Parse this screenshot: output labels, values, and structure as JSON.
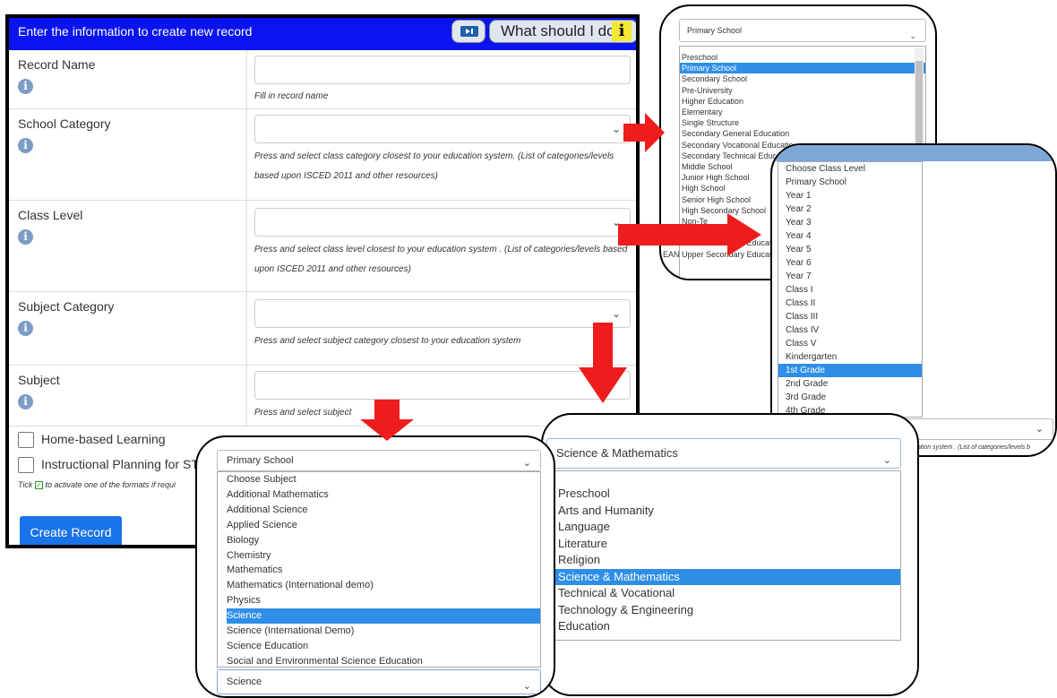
{
  "form": {
    "header": "Enter the information to create new record",
    "help_label": "What should I do?",
    "help_icon": "i",
    "info_icon": "i",
    "fields": [
      {
        "label": "Record Name",
        "hint": "Fill in record name",
        "type": "text"
      },
      {
        "label": "School Category",
        "hint": "Press and select class category closest to your education system. (List of categories/levels based upon ISCED 2011 and other resources)",
        "type": "select"
      },
      {
        "label": "Class Level",
        "hint": "Press and select class level closest to your education system . (List of categories/levels based upon ISCED 2011 and other resources)",
        "type": "select"
      },
      {
        "label": "Subject Category",
        "hint": "Press and select subject category closest to your education system",
        "type": "select"
      },
      {
        "label": "Subject",
        "hint": "Press and select subject",
        "type": "text"
      }
    ],
    "checkboxes": [
      "Home-based Learning",
      "Instructional Planning for STE"
    ],
    "checkbox_hint_prefix": "Tick",
    "checkbox_hint_suffix": "to activate one of the formats if requi",
    "create_button": "Create Record"
  },
  "school_panel": {
    "selected_value": "Primary School",
    "options": [
      "Preschool",
      "Primary School",
      "Secondary School",
      "Pre-University",
      "Higher Education",
      "Elementary",
      "Single Structure",
      "Secondary General Education",
      "Secondary Vocational Educatio",
      "Secondary Technical Educatio",
      "Middle School",
      "Junior High School",
      "High School",
      "Senior High School",
      "High Secondary School",
      "Non-Te",
      "Tertiary Education",
      "Lower Secondary Educat",
      "Upper Secondary Educat"
    ],
    "selected_index": 1,
    "side_text": "EAN"
  },
  "class_panel": {
    "options": [
      "Choose Class Level",
      "Primary School",
      "Year 1",
      "Year 2",
      "Year 3",
      "Year 4",
      "Year 5",
      "Year 6",
      "Year 7",
      "Class I",
      "Class II",
      "Class III",
      "Class IV",
      "Class V",
      "Kindergarten",
      "1st Grade",
      "2nd Grade",
      "3rd Grade",
      "4th Grade"
    ],
    "selected_index": 15,
    "footer_hint": "ation system . (List of categories/levels b"
  },
  "subject_panel": {
    "top_value": "Primary School",
    "options": [
      "Choose Subject",
      "Additional Mathematics",
      "Additional Science",
      "Applied Science",
      "Biology",
      "Chemistry",
      "Mathematics",
      "Mathematics (International demo)",
      "Physics",
      "Science",
      "Science (International Demo)",
      "Science Education",
      "Social and Environmental Science Education"
    ],
    "selected_index": 9,
    "bottom_value": "Science"
  },
  "subject_category_panel": {
    "selected_value": "Science & Mathematics",
    "options": [
      "Preschool",
      "Arts and Humanity",
      "Language",
      "Literature",
      "Religion",
      "Science & Mathematics",
      "Technical & Vocational",
      "Technology & Engineering",
      "Education"
    ],
    "selected_index": 5
  },
  "colors": {
    "header_blue": "#0a14f0",
    "button_blue": "#1a73e8",
    "highlight": "#2f8fe8",
    "arrow_red": "#ee1c1c"
  }
}
